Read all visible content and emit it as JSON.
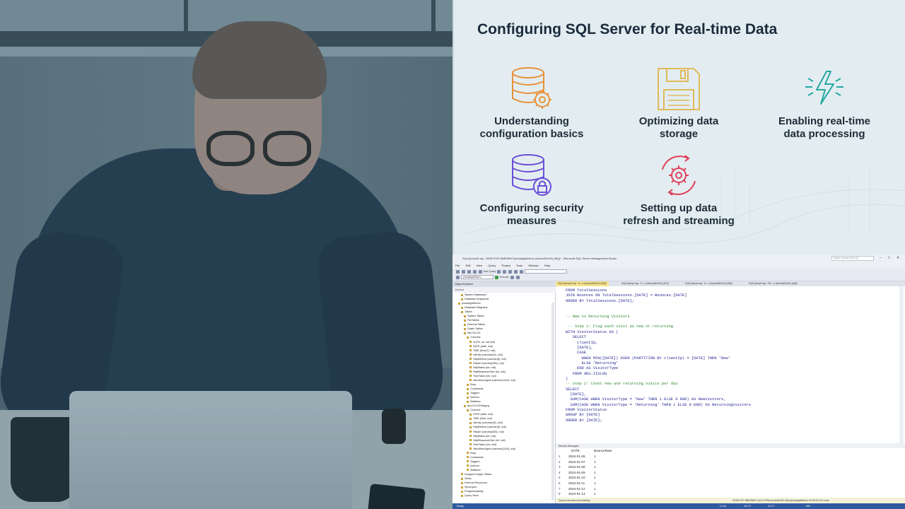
{
  "slide": {
    "title": "Configuring SQL Server for Real-time Data",
    "topics": [
      {
        "label": "Understanding\nconfiguration basics",
        "icon": "database-gear-icon"
      },
      {
        "label": "Optimizing data\nstorage",
        "icon": "floppy-disk-icon"
      },
      {
        "label": "Enabling real-time\ndata processing",
        "icon": "lightning-bolt-icon"
      },
      {
        "label": "Configuring security\nmeasures",
        "icon": "database-lock-icon"
      },
      {
        "label": "Setting up data\nrefresh and streaming",
        "icon": "gear-refresh-icon"
      }
    ],
    "colors": {
      "orange": "#e8923a",
      "gold": "#e0ba5a",
      "teal": "#25a8a0",
      "purple": "#6b4fd8",
      "red": "#e0405a"
    }
  },
  "ssms": {
    "title": "SQLQuery16.sql - DESKTOP-8NE9NMY.pluralsightDemo (AzureAD\\US) (55))* - Microsoft SQL Server Management Studio",
    "quick_launch": "Quick Launch (Ctrl+Q)",
    "menu": [
      "File",
      "Edit",
      "View",
      "Query",
      "Project",
      "Tools",
      "Window",
      "Help"
    ],
    "toolbar": {
      "new_query": "New Query",
      "database": "pluralsightDemo",
      "execute": "Execute"
    },
    "object_explorer": {
      "title": "Object Explorer",
      "connect": "Connect",
      "tree": [
        "System Databases",
        "Database Snapshots",
        "pluralsightDemo",
        "Database Diagrams",
        "Tables",
        "System Tables",
        "FileTables",
        "External Tables",
        "Graph Tables",
        "dbo.ISLOG",
        "Columns",
        "id (PK, int, not null)",
        "DATE (date, null)",
        "TIME (time(7), null)",
        "clientIp (varchar(45), null)",
        "HttpMethod (varchar(8), null)",
        "HttpUrl (varchar(255), null)",
        "HttpStatus (int, null)",
        "HttpResponseSize (int, null)",
        "TimeTaken (int, null)",
        "clientUserAgent (varchar(1024), null)",
        "Keys",
        "Constraints",
        "Triggers",
        "Indexes",
        "Statistics",
        "dbo.ISLOGStaging",
        "Columns",
        "DATE (date, null)",
        "TIME (time, null)",
        "clientIp (varchar(45), null)",
        "HttpMethod (varchar(8), null)",
        "HttpUrl (varchar(255), null)",
        "HttpStatus (int, null)",
        "HttpResponseSize (int, null)",
        "TimeTaken (int, null)",
        "clientUserAgent (varchar(1024), null)",
        "Keys",
        "Constraints",
        "Triggers",
        "Indexes",
        "Statistics",
        "Dropped Ledger Tables",
        "Views",
        "External Resources",
        "Synonyms",
        "Programmability",
        "Query Store"
      ]
    },
    "tabs": [
      "SQLQuery16.sql - D...n (AzureAD\\US) (55))*",
      "SQLQuery1.sql - D...n (AzureAD\\US) (67))*",
      "SQLQuery4.sql - D...n (AzureAD\\US) (69))*",
      "SQLQuery3.sql - DE...n (AzureAD\\US) (66))*"
    ],
    "code": [
      "FROM TotalSessions",
      "JOIN Bounces ON TotalSessions.[DATE] = Bounces.[DATE]",
      "ORDER BY TotalSessions.[DATE];",
      "",
      "",
      "-- New vs Returning Visitors",
      "",
      " -- Step 1: Flag each visit as new or returning",
      "WITH VisitorStatus AS (",
      "   SELECT",
      "     clientIp,",
      "     [DATE],",
      "     CASE",
      "       WHEN MIN([DATE]) OVER (PARTITION BY clientIp) = [DATE] THEN 'New'",
      "       ELSE 'Returning'",
      "     END AS VisitorType",
      "   FROM dbo.IISLOG",
      ")",
      "-- Step 2: Count new and returning visits per day",
      "SELECT",
      "  [DATE],",
      "  SUM(CASE WHEN VisitorType = 'New' THEN 1 ELSE 0 END) AS NewVisitors,",
      "  SUM(CASE WHEN VisitorType = 'Returning' THEN 1 ELSE 0 END) AS ReturningVisitors",
      "FROM VisitorStatus",
      "GROUP BY [DATE]",
      "ORDER BY [DATE];"
    ],
    "results_tabs": "Results   Messages",
    "results": {
      "columns": [
        "DATE",
        "BounceRate"
      ],
      "rows": [
        [
          "1",
          "2024-01-06",
          "1"
        ],
        [
          "2",
          "2024-01-07",
          "1"
        ],
        [
          "3",
          "2024-01-08",
          "1"
        ],
        [
          "4",
          "2024-01-09",
          "1"
        ],
        [
          "5",
          "2024-01-10",
          "1"
        ],
        [
          "6",
          "2024-01-11",
          "1"
        ],
        [
          "7",
          "2024-01-12",
          "1"
        ],
        [
          "8",
          "2024-01-13",
          "1"
        ]
      ]
    },
    "query_status": "Query executed successfully.",
    "query_status_right": "DESKTOP-8NE9NMY (16.0 RTM)   AzureAD\\US (55)   pluralsightDemo   00:00:00   213 rows",
    "status": {
      "ready": "Ready",
      "ln": "Ln 16",
      "col": "Col 17",
      "ch": "Ch 17",
      "ins": "INS"
    }
  }
}
